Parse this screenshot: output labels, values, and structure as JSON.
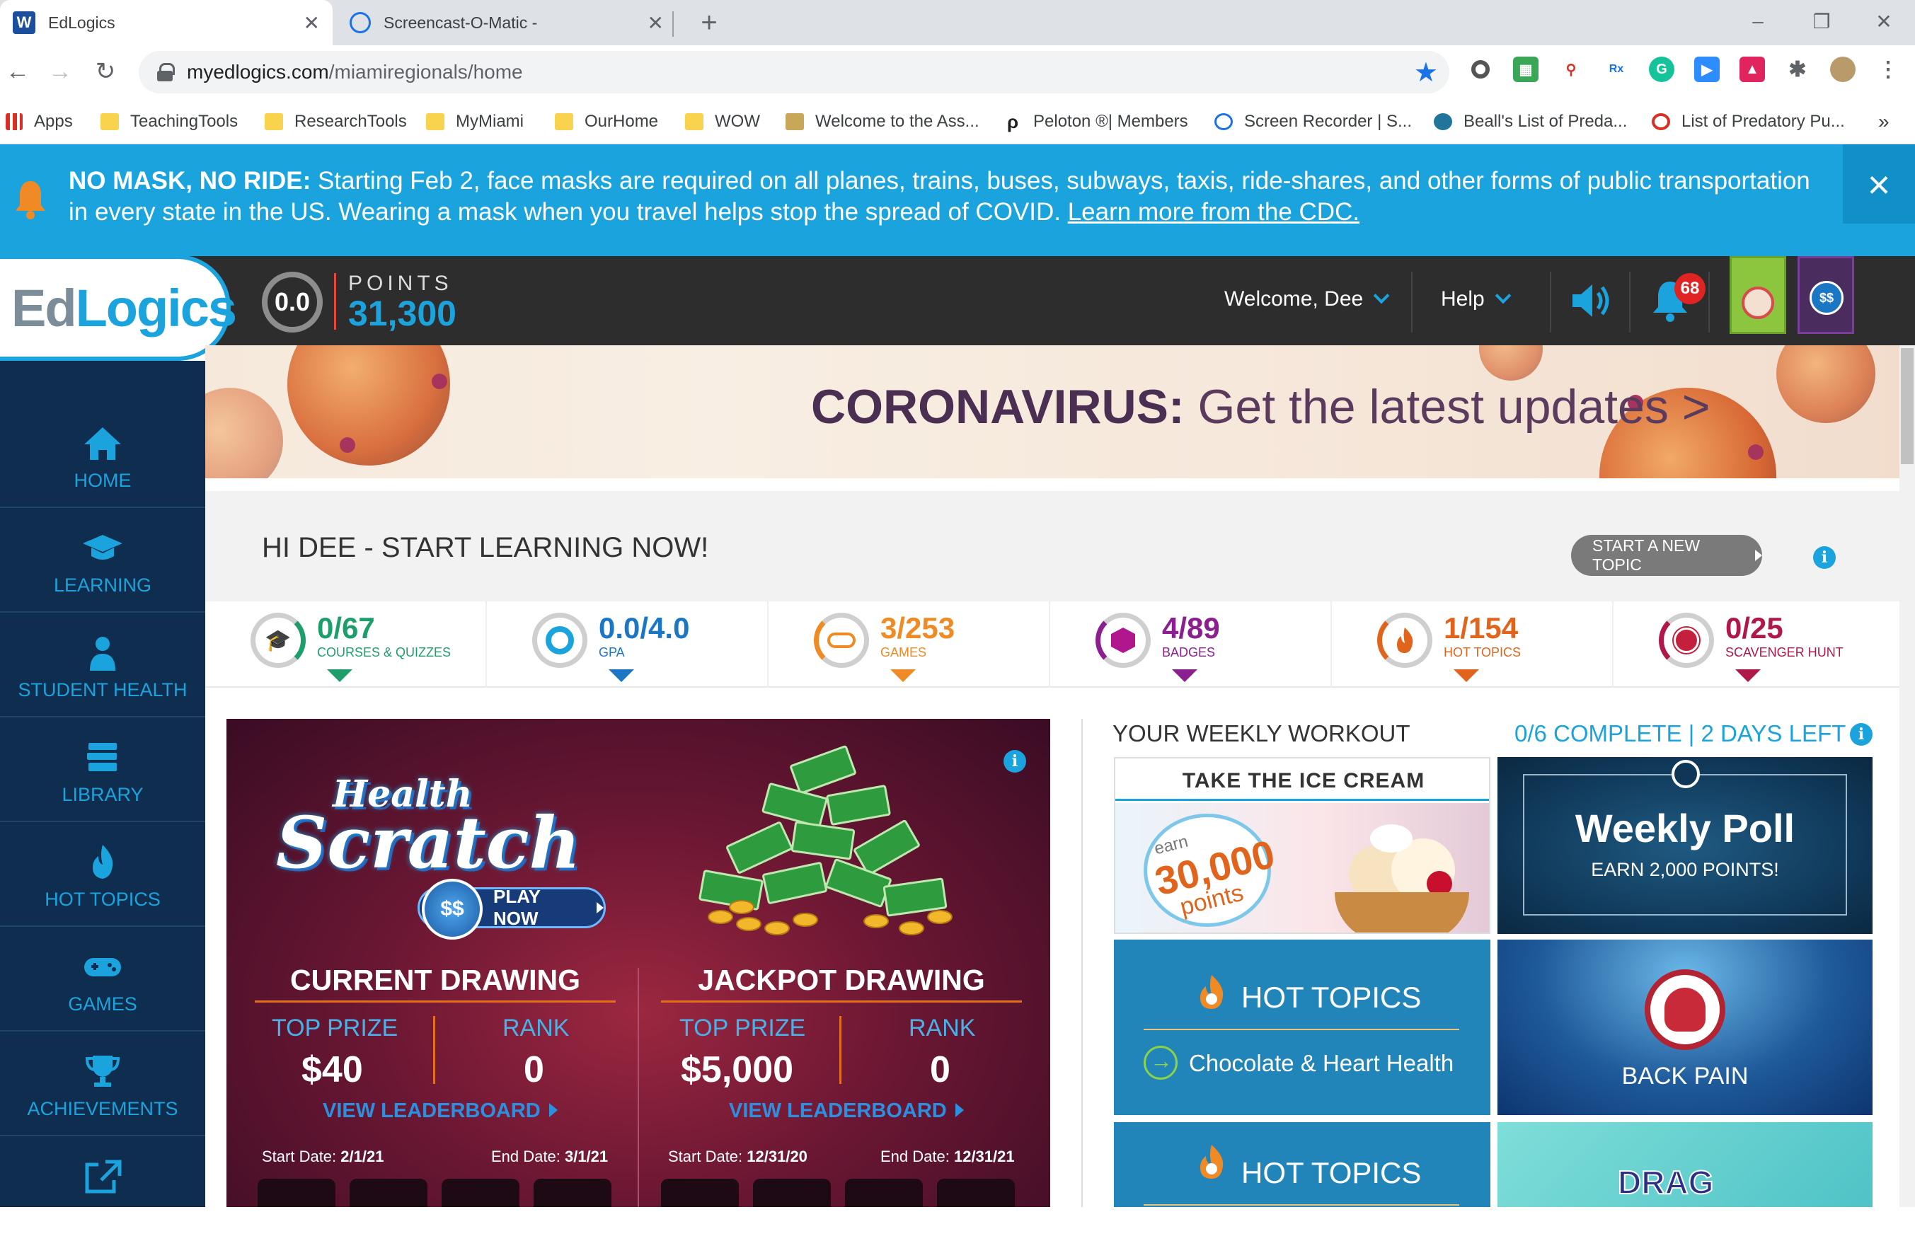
{
  "browser": {
    "tabs": [
      {
        "title": "EdLogics",
        "favicon": "W"
      },
      {
        "title": "Screencast-O-Matic -"
      }
    ],
    "url_host": "myedlogics.com",
    "url_path": "/miamiregionals/home",
    "bookmarks": [
      {
        "label": "Apps",
        "icon": "apps-grid-icon"
      },
      {
        "label": "TeachingTools",
        "icon": "folder-icon"
      },
      {
        "label": "ResearchTools",
        "icon": "folder-icon"
      },
      {
        "label": "MyMiami",
        "icon": "folder-icon"
      },
      {
        "label": "OurHome",
        "icon": "folder-icon"
      },
      {
        "label": "WOW",
        "icon": "folder-icon"
      },
      {
        "label": "Welcome to the Ass...",
        "icon": "site-icon"
      },
      {
        "label": "Peloton ®| Members",
        "icon": "peloton-icon"
      },
      {
        "label": "Screen Recorder | S...",
        "icon": "site-icon"
      },
      {
        "label": "Beall's List of Preda...",
        "icon": "wordpress-icon"
      },
      {
        "label": "List of Predatory Pu...",
        "icon": "blocked-icon"
      }
    ],
    "more_bookmarks": "»"
  },
  "alert": {
    "bold": "NO MASK, NO RIDE:",
    "text": " Starting Feb 2, face masks are required on all planes, trains, buses, subways, taxis, ride-shares, and other forms of public transportation in every state in the US. Wearing a mask when you travel helps stop the spread of COVID. ",
    "link": "Learn more from the CDC.",
    "close": "×"
  },
  "header": {
    "logo_ed": "Ed",
    "logo_logics": "Logics",
    "gpa": "0.0",
    "points_label": "POINTS",
    "points_value": "31,300",
    "welcome": "Welcome, Dee",
    "help": "Help",
    "notifications": "68"
  },
  "sidebar": {
    "items": [
      {
        "label": "HOME",
        "icon": "home-icon"
      },
      {
        "label": "LEARNING",
        "icon": "graduation-cap-icon"
      },
      {
        "label": "STUDENT HEALTH",
        "icon": "student-icon"
      },
      {
        "label": "LIBRARY",
        "icon": "books-icon"
      },
      {
        "label": "HOT TOPICS",
        "icon": "flame-icon"
      },
      {
        "label": "GAMES",
        "icon": "gamepad-icon"
      },
      {
        "label": "ACHIEVEMENTS",
        "icon": "trophy-icon"
      },
      {
        "label": "",
        "icon": "external-link-icon"
      }
    ]
  },
  "banner": {
    "bold": "CORONAVIRUS:",
    "text": " Get the latest updates >"
  },
  "hi": {
    "title": "HI DEE - START LEARNING NOW!",
    "start_button": "START A NEW TOPIC"
  },
  "stats": [
    {
      "value": "0/67",
      "label": "COURSES & QUIZZES",
      "color": "#1e9e6a",
      "icon": "graduation-cap-icon"
    },
    {
      "value": "0.0/4.0",
      "label": "GPA",
      "color": "#1b76c4",
      "icon": "gpa-ring-icon"
    },
    {
      "value": "3/253",
      "label": "GAMES",
      "color": "#f08a24",
      "icon": "gamepad-icon"
    },
    {
      "value": "4/89",
      "label": "BADGES",
      "color": "#8b1f8f",
      "icon": "hexagon-badge-icon"
    },
    {
      "value": "1/154",
      "label": "HOT TOPICS",
      "color": "#e0641c",
      "icon": "flame-icon"
    },
    {
      "value": "0/25",
      "label": "SCAVENGER HUNT",
      "color": "#b0184a",
      "icon": "map-icon"
    }
  ],
  "scratch": {
    "logo_top": "Health",
    "logo_main": "Scratch",
    "coin": "$$",
    "play": "PLAY NOW",
    "current": {
      "title": "CURRENT DRAWING",
      "prize_label": "TOP PRIZE",
      "prize": "$40",
      "rank_label": "RANK",
      "rank": "0",
      "leaderboard": "VIEW LEADERBOARD",
      "start_label": "Start Date:",
      "start": "2/1/21",
      "end_label": "End Date:",
      "end": "3/1/21"
    },
    "jackpot": {
      "title": "JACKPOT DRAWING",
      "prize_label": "TOP PRIZE",
      "prize": "$5,000",
      "rank_label": "RANK",
      "rank": "0",
      "leaderboard": "VIEW LEADERBOARD",
      "start_label": "Start Date:",
      "start": "12/31/20",
      "end_label": "End Date:",
      "end": "12/31/21"
    }
  },
  "workout": {
    "title": "YOUR WEEKLY WORKOUT",
    "status": "0/6 COMPLETE | 2 DAYS LEFT",
    "ice": {
      "title": "TAKE THE ICE CREAM CHALLENGE",
      "earn": "earn",
      "points": "30,000",
      "points_word": "points"
    },
    "poll": {
      "title": "Weekly Poll",
      "sub": "EARN 2,000 POINTS!"
    },
    "hot1": {
      "title": "HOT TOPICS",
      "topic": "Chocolate & Heart Health"
    },
    "back": {
      "label": "BACK PAIN"
    },
    "hot2": {
      "title": "HOT TOPICS"
    },
    "drag": {
      "label": "DRAG"
    }
  }
}
